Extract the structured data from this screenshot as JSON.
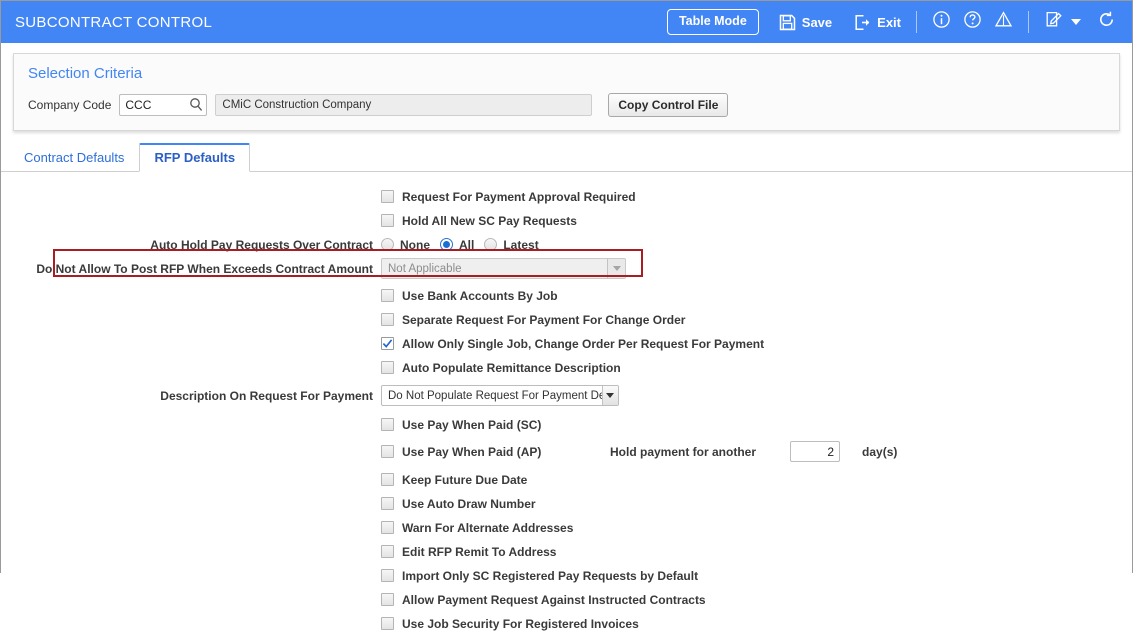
{
  "header": {
    "title": "SUBCONTRACT CONTROL",
    "table_mode_label": "Table Mode",
    "save_label": "Save",
    "exit_label": "Exit",
    "icons": [
      "save-icon",
      "exit-icon",
      "info-icon",
      "help-icon",
      "warning-icon",
      "notes-icon",
      "chevron-down-icon",
      "refresh-icon"
    ],
    "accent_color": "#4285f4"
  },
  "criteria": {
    "title": "Selection Criteria",
    "company_code_label": "Company Code",
    "company_code_value": "CCC",
    "company_name_value": "CMiC Construction Company",
    "copy_control_file_label": "Copy Control File"
  },
  "tabs": [
    {
      "label": "Contract Defaults",
      "active": false
    },
    {
      "label": "RFP Defaults",
      "active": true
    }
  ],
  "form": {
    "checkbox_top": [
      {
        "label": "Request For Payment Approval Required",
        "checked": false
      },
      {
        "label": "Hold All New SC Pay Requests",
        "checked": false
      }
    ],
    "auto_hold": {
      "label": "Auto Hold Pay Requests Over Contract",
      "options": [
        {
          "label": "None",
          "selected": false
        },
        {
          "label": "All",
          "selected": true
        },
        {
          "label": "Latest",
          "selected": false
        }
      ]
    },
    "post_rfp": {
      "label": "Do Not Allow To Post RFP When Exceeds Contract Amount",
      "value": "Not Applicable",
      "disabled": true,
      "highlighted": true,
      "highlight_color": "#a91c22"
    },
    "checkbox_mid": [
      {
        "label": "Use Bank Accounts By Job",
        "checked": false
      },
      {
        "label": "Separate Request For Payment For Change Order",
        "checked": false
      },
      {
        "label": "Allow Only Single Job, Change Order Per Request For Payment",
        "checked": true
      },
      {
        "label": "Auto Populate Remittance Description",
        "checked": false
      }
    ],
    "description_rfp": {
      "label": "Description On Request For Payment",
      "value": "Do Not Populate Request For Payment Desc"
    },
    "pay_when_paid_sc": {
      "label": "Use Pay When Paid (SC)",
      "checked": false
    },
    "pay_when_paid_ap": {
      "label": "Use Pay When Paid (AP)",
      "checked": false
    },
    "hold_payment": {
      "label": "Hold payment for another",
      "value": "2",
      "unit_label": "day(s)"
    },
    "checkbox_bottom": [
      {
        "label": "Keep Future Due Date",
        "checked": false
      },
      {
        "label": "Use Auto Draw Number",
        "checked": false
      },
      {
        "label": "Warn For Alternate Addresses",
        "checked": false
      },
      {
        "label": "Edit RFP Remit To Address",
        "checked": false
      },
      {
        "label": "Import Only SC Registered Pay Requests by Default",
        "checked": false
      },
      {
        "label": "Allow Payment Request Against Instructed Contracts",
        "checked": false
      },
      {
        "label": "Use Job Security For Registered Invoices",
        "checked": false
      }
    ]
  }
}
